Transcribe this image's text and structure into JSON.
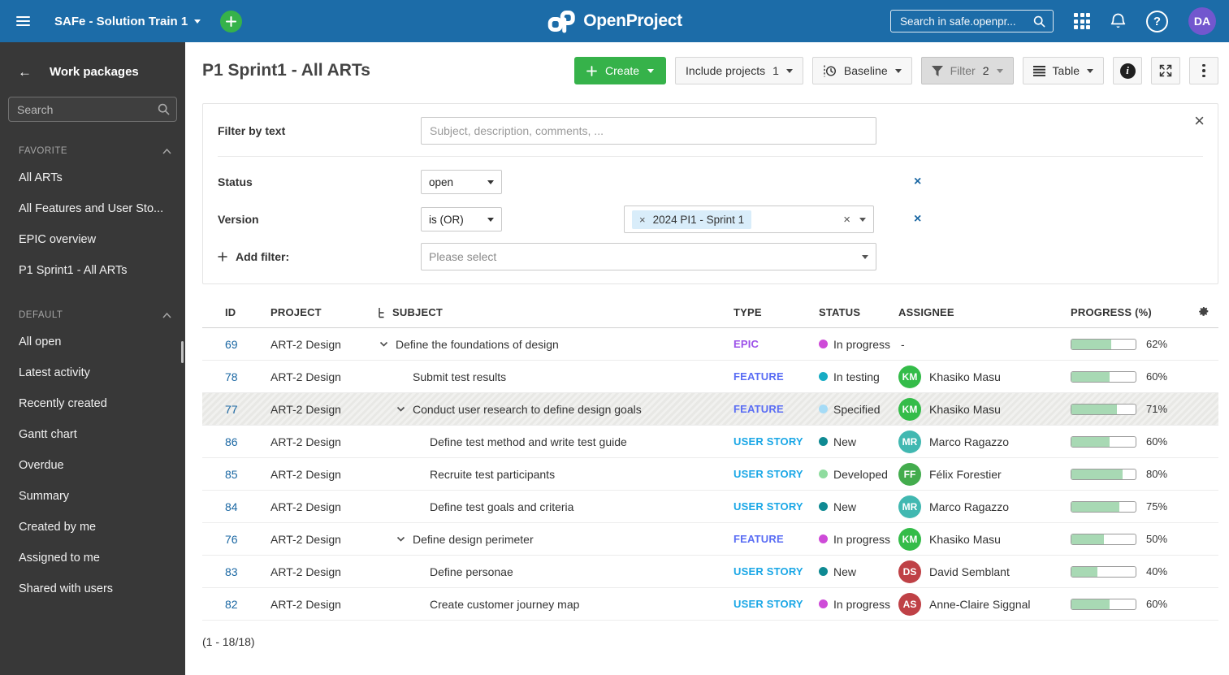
{
  "topbar": {
    "project_selector": "SAFe - Solution Train 1",
    "logo_text": "OpenProject",
    "search_placeholder": "Search in safe.openpr...",
    "avatar_initials": "DA"
  },
  "sidebar": {
    "title": "Work packages",
    "search_placeholder": "Search",
    "sections": [
      {
        "label": "FAVORITE",
        "items": [
          "All ARTs",
          "All Features and User Sto...",
          "EPIC overview",
          "P1 Sprint1 - All ARTs"
        ]
      },
      {
        "label": "DEFAULT",
        "items": [
          "All open",
          "Latest activity",
          "Recently created",
          "Gantt chart",
          "Overdue",
          "Summary",
          "Created by me",
          "Assigned to me",
          "Shared with users"
        ]
      }
    ]
  },
  "toolbar": {
    "title": "P1 Sprint1 - All ARTs",
    "create_label": "Create",
    "include_projects_label": "Include projects",
    "include_projects_count": "1",
    "baseline_label": "Baseline",
    "filter_label": "Filter",
    "filter_count": "2",
    "table_label": "Table"
  },
  "filters": {
    "text_label": "Filter by text",
    "text_placeholder": "Subject, description, comments, ...",
    "status_label": "Status",
    "status_value": "open",
    "version_label": "Version",
    "version_operator": "is (OR)",
    "version_chip": "2024 PI1 - Sprint 1",
    "add_filter_label": "Add filter:",
    "add_filter_placeholder": "Please select"
  },
  "table": {
    "columns": {
      "id": "ID",
      "project": "PROJECT",
      "subject": "SUBJECT",
      "type": "TYPE",
      "status": "STATUS",
      "assignee": "ASSIGNEE",
      "progress": "PROGRESS (%)"
    },
    "rows": [
      {
        "id": "69",
        "project": "ART-2 Design",
        "indent": 0,
        "expandable": true,
        "subject": "Define the foundations of design",
        "type": "EPIC",
        "type_color": "#9B50E8",
        "status": "In progress",
        "status_color": "#CE4BD8",
        "assignee_initials": "",
        "assignee_name": "-",
        "avatar_color": "",
        "progress": 62,
        "highlighted": false
      },
      {
        "id": "78",
        "project": "ART-2 Design",
        "indent": 1,
        "expandable": false,
        "subject": "Submit test results",
        "type": "FEATURE",
        "type_color": "#5A6DF4",
        "status": "In testing",
        "status_color": "#17ACC4",
        "assignee_initials": "KM",
        "assignee_name": "Khasiko Masu",
        "avatar_color": "#34BC49",
        "progress": 60,
        "highlighted": false
      },
      {
        "id": "77",
        "project": "ART-2 Design",
        "indent": 1,
        "expandable": true,
        "subject": "Conduct user research to define design goals",
        "type": "FEATURE",
        "type_color": "#5A6DF4",
        "status": "Specified",
        "status_color": "#A5DBF6",
        "assignee_initials": "KM",
        "assignee_name": "Khasiko Masu",
        "avatar_color": "#34BC49",
        "progress": 71,
        "highlighted": true
      },
      {
        "id": "86",
        "project": "ART-2 Design",
        "indent": 2,
        "expandable": false,
        "subject": "Define test method and write test guide",
        "type": "USER STORY",
        "type_color": "#1AA7E6",
        "status": "New",
        "status_color": "#0F8A93",
        "assignee_initials": "MR",
        "assignee_name": "Marco Ragazzo",
        "avatar_color": "#41B8B1",
        "progress": 60,
        "highlighted": false
      },
      {
        "id": "85",
        "project": "ART-2 Design",
        "indent": 2,
        "expandable": false,
        "subject": "Recruite test participants",
        "type": "USER STORY",
        "type_color": "#1AA7E6",
        "status": "Developed",
        "status_color": "#8FDC9F",
        "assignee_initials": "FF",
        "assignee_name": "Félix Forestier",
        "avatar_color": "#43AC4D",
        "progress": 80,
        "highlighted": false
      },
      {
        "id": "84",
        "project": "ART-2 Design",
        "indent": 2,
        "expandable": false,
        "subject": "Define test goals and criteria",
        "type": "USER STORY",
        "type_color": "#1AA7E6",
        "status": "New",
        "status_color": "#0F8A93",
        "assignee_initials": "MR",
        "assignee_name": "Marco Ragazzo",
        "avatar_color": "#41B8B1",
        "progress": 75,
        "highlighted": false
      },
      {
        "id": "76",
        "project": "ART-2 Design",
        "indent": 1,
        "expandable": true,
        "subject": "Define design perimeter",
        "type": "FEATURE",
        "type_color": "#5A6DF4",
        "status": "In progress",
        "status_color": "#CE4BD8",
        "assignee_initials": "KM",
        "assignee_name": "Khasiko Masu",
        "avatar_color": "#34BC49",
        "progress": 50,
        "highlighted": false
      },
      {
        "id": "83",
        "project": "ART-2 Design",
        "indent": 2,
        "expandable": false,
        "subject": "Define personae",
        "type": "USER STORY",
        "type_color": "#1AA7E6",
        "status": "New",
        "status_color": "#0F8A93",
        "assignee_initials": "DS",
        "assignee_name": "David Semblant",
        "avatar_color": "#BF4146",
        "progress": 40,
        "highlighted": false
      },
      {
        "id": "82",
        "project": "ART-2 Design",
        "indent": 2,
        "expandable": false,
        "subject": "Create customer journey map",
        "type": "USER STORY",
        "type_color": "#1AA7E6",
        "status": "In progress",
        "status_color": "#CE4BD8",
        "assignee_initials": "AS",
        "assignee_name": "Anne-Claire Siggnal",
        "avatar_color": "#BF4146",
        "progress": 60,
        "highlighted": false
      }
    ]
  },
  "footer": {
    "count_label": "(1 - 18/18)"
  },
  "colors": {
    "header_blue": "#1C6CA8",
    "accent_green": "#36B24A",
    "avatar_purple": "#7257CE",
    "link_blue": "#1A67A3",
    "progress_fill": "#A8D9B4",
    "chip_blue": "#D9EDFA",
    "type_epic": "#9B50E8",
    "type_feature": "#5A6DF4",
    "type_user_story": "#1AA7E6",
    "status_in_progress": "#CE4BD8",
    "status_in_testing": "#17ACC4",
    "status_specified": "#A5DBF6",
    "status_new": "#0F8A93",
    "status_developed": "#8FDC9F"
  }
}
